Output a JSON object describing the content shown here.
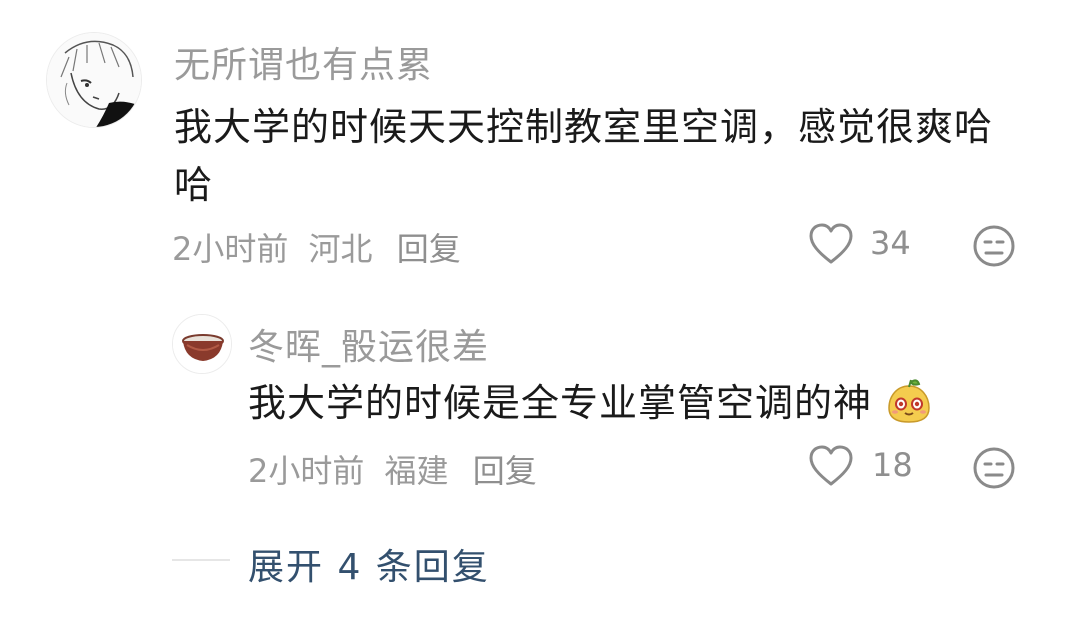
{
  "comment": {
    "username": "无所谓也有点累",
    "text": "我大学的时候天天控制教室里空调，感觉很爽哈哈",
    "time": "2小时前",
    "location": "河北",
    "reply_label": "回复",
    "likes": "34"
  },
  "reply": {
    "username": "冬晖_骰运很差",
    "text": "我大学的时候是全专业掌管空调的神",
    "time": "2小时前",
    "location": "福建",
    "reply_label": "回复",
    "likes": "18"
  },
  "expand": {
    "label": "展开 4 条回复"
  },
  "colors": {
    "username": "#9a9a9a",
    "text": "#1a1a1a",
    "link": "#33506e",
    "icon": "#8a8a8a"
  }
}
